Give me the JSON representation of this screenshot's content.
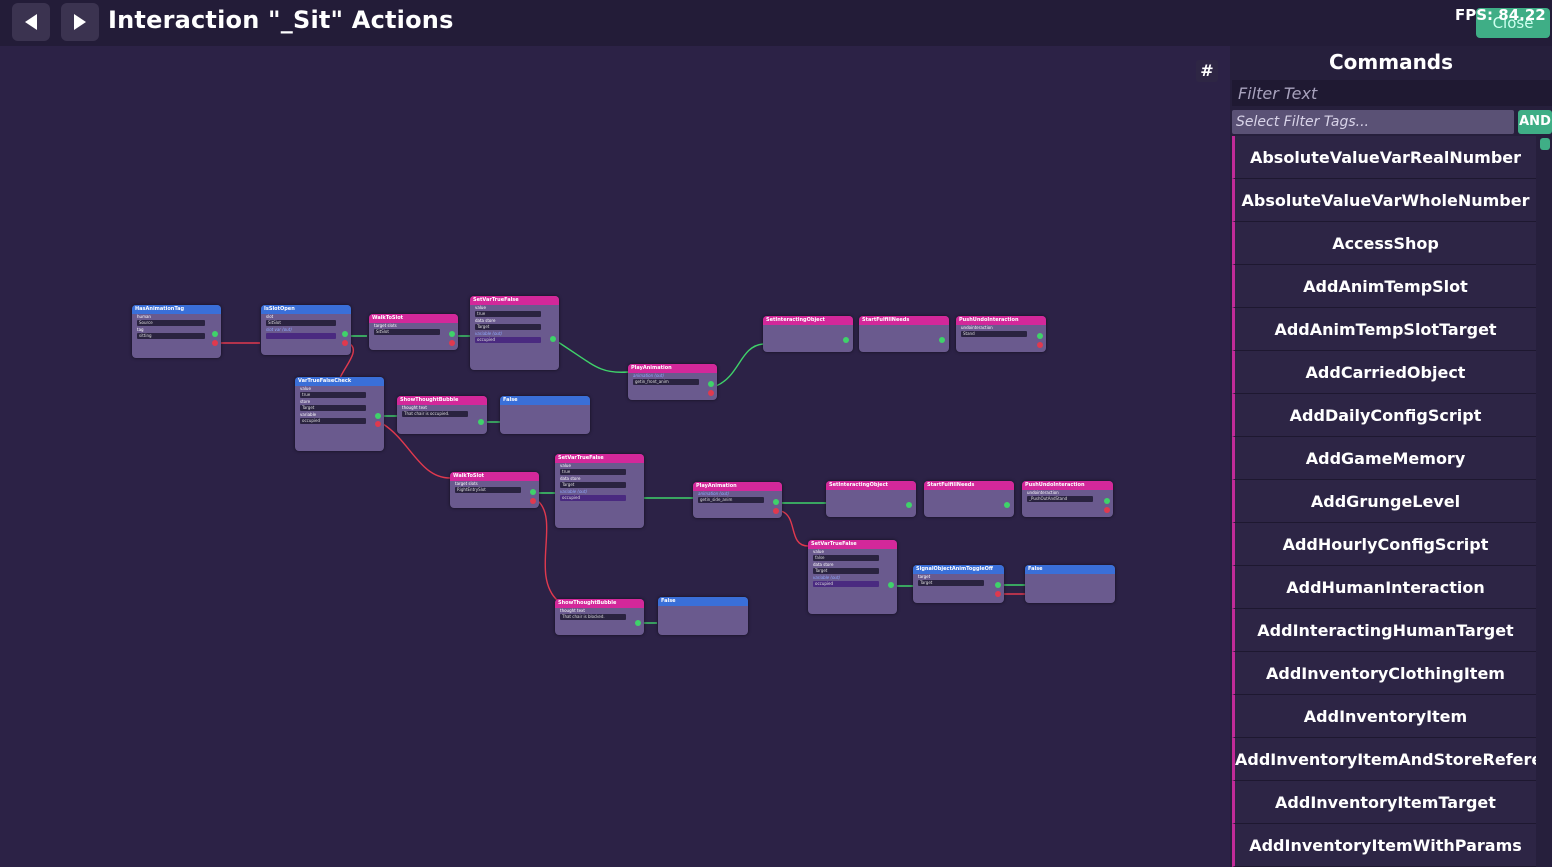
{
  "window": {
    "title": "Interaction \"_Sit\" Actions",
    "close_label": "Close",
    "fps_text": "FPS: 84.22"
  },
  "canvas": {
    "grid_toggle_label": "#",
    "nodes": {
      "n1": {
        "title": "HasAnimationTag",
        "rows": [
          "human",
          "tag"
        ],
        "fields": [
          "Source",
          "sitting"
        ]
      },
      "n2": {
        "title": "IsSlotOpen",
        "rows": [
          "slot",
          "slot var (out)"
        ],
        "fields": [
          "SitSlot",
          ""
        ]
      },
      "n3": {
        "title": "WalkToSlot",
        "rows": [
          "target slots"
        ],
        "fields": [
          "SitSlot"
        ]
      },
      "n4": {
        "title": "SetVarTrueFalse",
        "rows": [
          "value",
          "data store",
          "variable (out)"
        ],
        "fields": [
          "true",
          "Target",
          "occupied"
        ]
      },
      "n5": {
        "title": "PlayAnimation",
        "rows": [
          "animation (out)"
        ],
        "fields": [
          "getin_front_anim"
        ]
      },
      "n6": {
        "title": "SetInteractingObject",
        "rows": [],
        "fields": []
      },
      "n7": {
        "title": "StartFulfillNeeds",
        "rows": [],
        "fields": []
      },
      "n8": {
        "title": "PushUndoInteraction",
        "rows": [
          "undointeraction"
        ],
        "fields": [
          "Stand"
        ]
      },
      "n9": {
        "title": "VarTrueFalseCheck",
        "rows": [
          "value",
          "store",
          "variable"
        ],
        "fields": [
          "true",
          "Target",
          "occupied"
        ]
      },
      "n10": {
        "title": "ShowThoughtBubble",
        "rows": [
          "thought text"
        ],
        "fields": [
          "That chair is occupied."
        ]
      },
      "n11": {
        "title": "False",
        "rows": [],
        "fields": []
      },
      "n12": {
        "title": "WalkToSlot",
        "rows": [
          "target slots"
        ],
        "fields": [
          "RightEntrySlot"
        ]
      },
      "n13": {
        "title": "SetVarTrueFalse",
        "rows": [
          "value",
          "data store",
          "variable (out)"
        ],
        "fields": [
          "true",
          "Target",
          "occupied"
        ]
      },
      "n14": {
        "title": "PlayAnimation",
        "rows": [
          "animation (out)"
        ],
        "fields": [
          "getin_side_anim"
        ]
      },
      "n15": {
        "title": "SetInteractingObject",
        "rows": [],
        "fields": []
      },
      "n16": {
        "title": "StartFulfillNeeds",
        "rows": [],
        "fields": []
      },
      "n17": {
        "title": "PushUndoInteraction",
        "rows": [
          "undointeraction"
        ],
        "fields": [
          "_PushOutAndStand"
        ]
      },
      "n18": {
        "title": "SetVarTrueFalse",
        "rows": [
          "value",
          "data store",
          "variable (out)"
        ],
        "fields": [
          "false",
          "Target",
          "occupied"
        ]
      },
      "n19": {
        "title": "SignalObjectAnimToggleOff",
        "rows": [
          "target"
        ],
        "fields": [
          "Target"
        ]
      },
      "n20": {
        "title": "False",
        "rows": [],
        "fields": []
      },
      "n21": {
        "title": "ShowThoughtBubble",
        "rows": [
          "thought text"
        ],
        "fields": [
          "That chair is blocked."
        ]
      },
      "n22": {
        "title": "False",
        "rows": [],
        "fields": []
      }
    }
  },
  "commands": {
    "title": "Commands",
    "filter_placeholder": "Filter Text",
    "tags_placeholder": "Select Filter Tags...",
    "and_label": "AND",
    "items": [
      "AbsoluteValueVarRealNumber",
      "AbsoluteValueVarWholeNumber",
      "AccessShop",
      "AddAnimTempSlot",
      "AddAnimTempSlotTarget",
      "AddCarriedObject",
      "AddDailyConfigScript",
      "AddGameMemory",
      "AddGrungeLevel",
      "AddHourlyConfigScript",
      "AddHumanInteraction",
      "AddInteractingHumanTarget",
      "AddInventoryClothingItem",
      "AddInventoryItem",
      "AddInventoryItemAndStoreReference",
      "AddInventoryItemTarget",
      "AddInventoryItemWithParams"
    ]
  },
  "colors": {
    "background": "#2c2246",
    "header_blue": "#3a6fd8",
    "header_pink": "#d3289a",
    "wire_green": "#3fd26a",
    "wire_red": "#e0394e",
    "accent": "#3fae86"
  }
}
